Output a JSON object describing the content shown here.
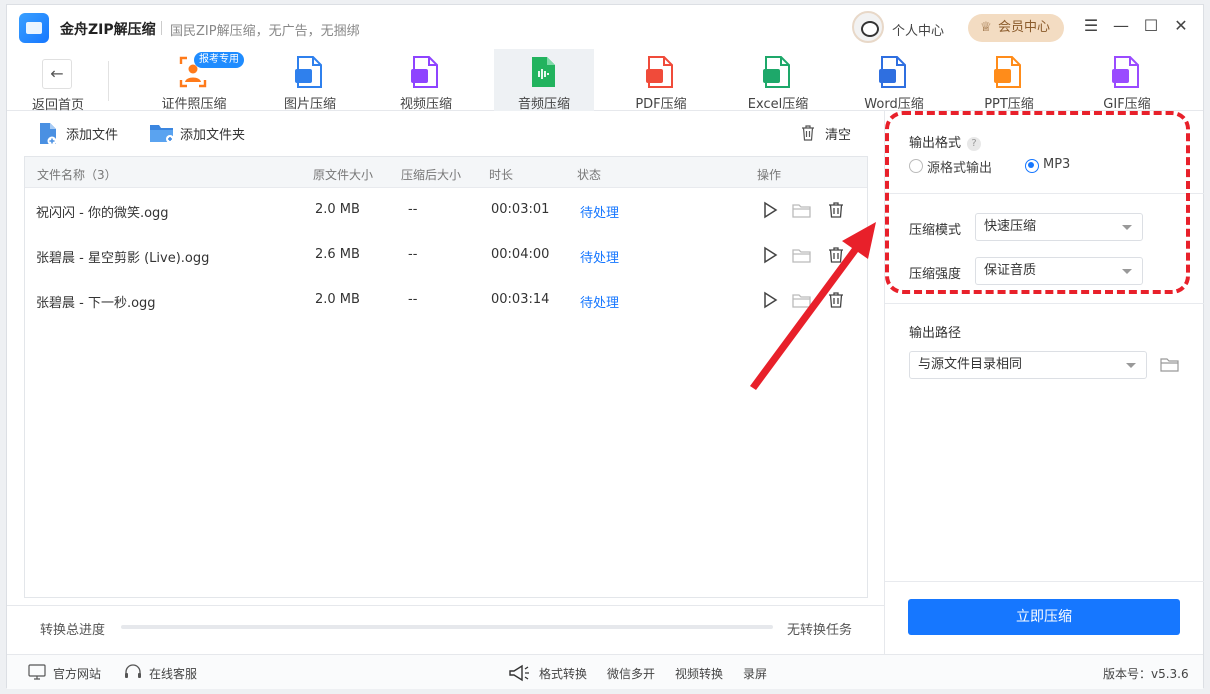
{
  "app": {
    "name": "金舟ZIP解压缩",
    "slogan": "国民ZIP解压缩，无广告，无捆绑"
  },
  "header": {
    "personal_center": "个人中心",
    "vip_center": "会员中心"
  },
  "window_controls": {
    "menu": "☰",
    "minimize": "—",
    "maximize": "☐",
    "close": "✕"
  },
  "toolbar": {
    "back_label": "返回首页",
    "tools": [
      {
        "label": "证件照压缩",
        "tag": "报考专用",
        "color": "#ff7a1a",
        "icon": "id-photo-icon"
      },
      {
        "label": "图片压缩",
        "color": "#2f80ed",
        "icon": "image-icon"
      },
      {
        "label": "视频压缩",
        "color": "#8e44ff",
        "icon": "video-icon"
      },
      {
        "label": "音频压缩",
        "color": "#22b35e",
        "icon": "audio-icon"
      },
      {
        "label": "PDF压缩",
        "color": "#f04b3a",
        "icon": "pdf-icon"
      },
      {
        "label": "Excel压缩",
        "color": "#1ea86a",
        "icon": "excel-icon"
      },
      {
        "label": "Word压缩",
        "color": "#2f6fe0",
        "icon": "word-icon"
      },
      {
        "label": "PPT压缩",
        "color": "#ff8c1a",
        "icon": "ppt-icon"
      },
      {
        "label": "GIF压缩",
        "color": "#9a4bff",
        "icon": "gif-icon"
      }
    ],
    "active_index": 3
  },
  "actions": {
    "add_file": "添加文件",
    "add_folder": "添加文件夹",
    "clear": "清空"
  },
  "table": {
    "headers": {
      "name": "文件名称（3）",
      "orig_size": "原文件大小",
      "comp_size": "压缩后大小",
      "duration": "时长",
      "status": "状态",
      "ops": "操作"
    },
    "rows": [
      {
        "name": "祝闪闪 - 你的微笑.ogg",
        "orig_size": "2.0 MB",
        "comp_size": "--",
        "duration": "00:03:01",
        "status": "待处理"
      },
      {
        "name": "张碧晨 - 星空剪影 (Live).ogg",
        "orig_size": "2.6 MB",
        "comp_size": "--",
        "duration": "00:04:00",
        "status": "待处理"
      },
      {
        "name": "张碧晨 - 下一秒.ogg",
        "orig_size": "2.0 MB",
        "comp_size": "--",
        "duration": "00:03:14",
        "status": "待处理"
      }
    ]
  },
  "progress": {
    "label": "转换总进度",
    "value": 0,
    "status": "无转换任务"
  },
  "settings": {
    "output_format_label": "输出格式",
    "format_options": [
      "源格式输出",
      "MP3"
    ],
    "selected_format": "MP3",
    "mode_label": "压缩模式",
    "mode_value": "快速压缩",
    "strength_label": "压缩强度",
    "strength_value": "保证音质",
    "path_label": "输出路径",
    "path_value": "与源文件目录相同",
    "compress_button": "立即压缩"
  },
  "annotation": {
    "color": "#e8202a"
  },
  "footer": {
    "website": "官方网站",
    "service": "在线客服",
    "links": [
      "格式转换",
      "微信多开",
      "视频转换",
      "录屏"
    ],
    "version": "版本号：v5.3.6"
  }
}
